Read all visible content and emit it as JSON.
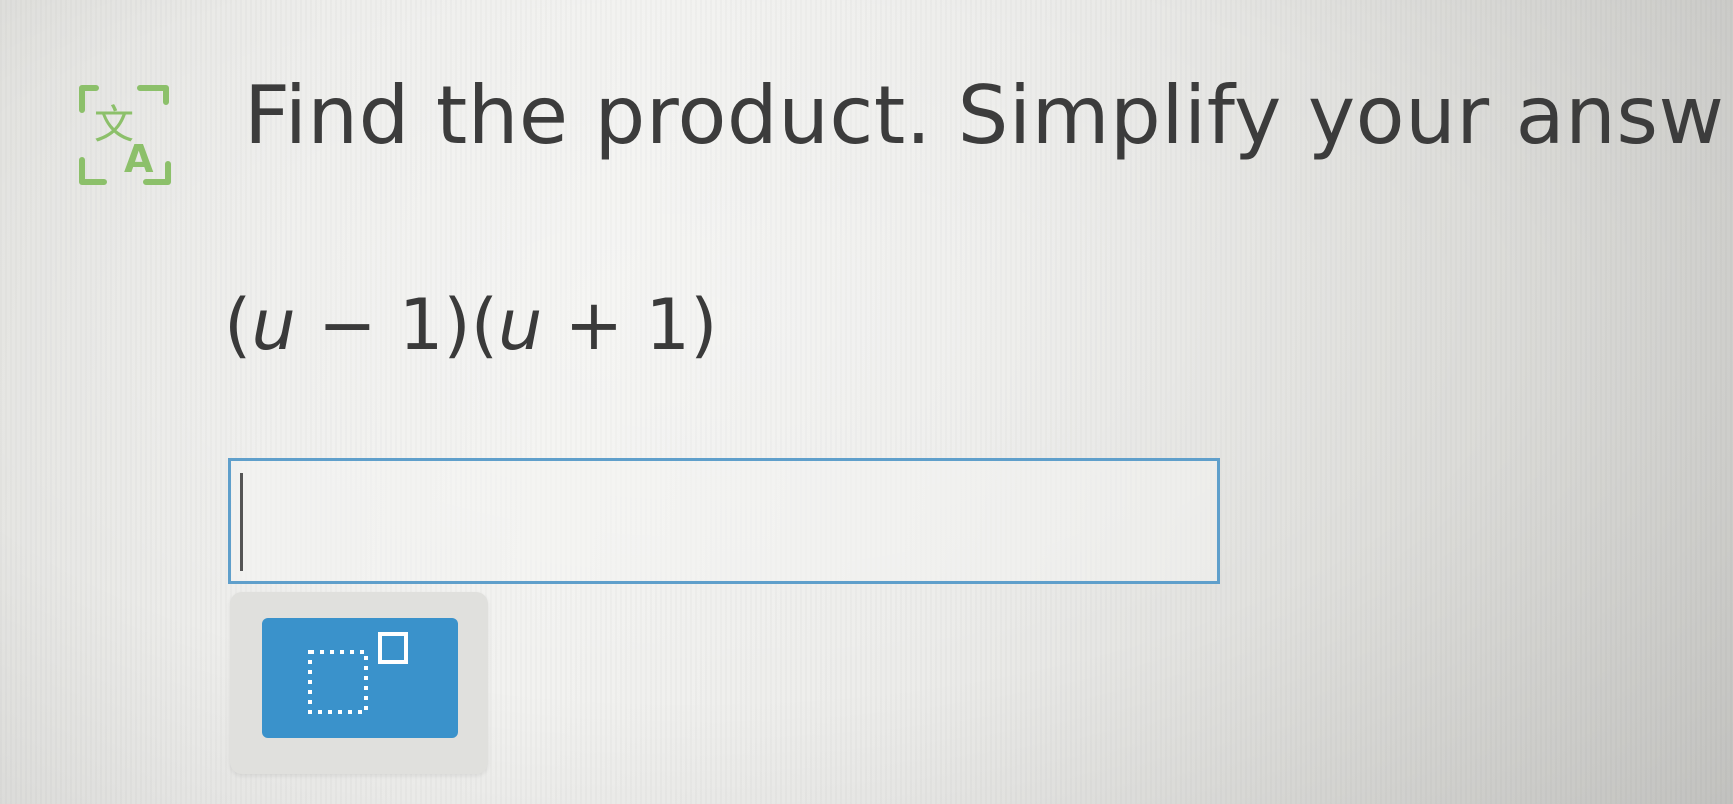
{
  "question": {
    "instruction": "Find the product. Simplify your answ",
    "expression": {
      "open1": "(",
      "var1": "u",
      "rest1": " − 1)(",
      "var2": "u",
      "rest2": " + 1)"
    }
  },
  "answer": {
    "value": ""
  },
  "toolbar": {
    "buttons": [
      {
        "icon": "exponent-template-icon"
      }
    ]
  },
  "icons": {
    "translate": "translate-icon"
  },
  "colors": {
    "accent_blue": "#3a92cb",
    "input_border": "#5f9fcb",
    "translate_green": "#8cc06a",
    "text": "#3c3c3c"
  }
}
